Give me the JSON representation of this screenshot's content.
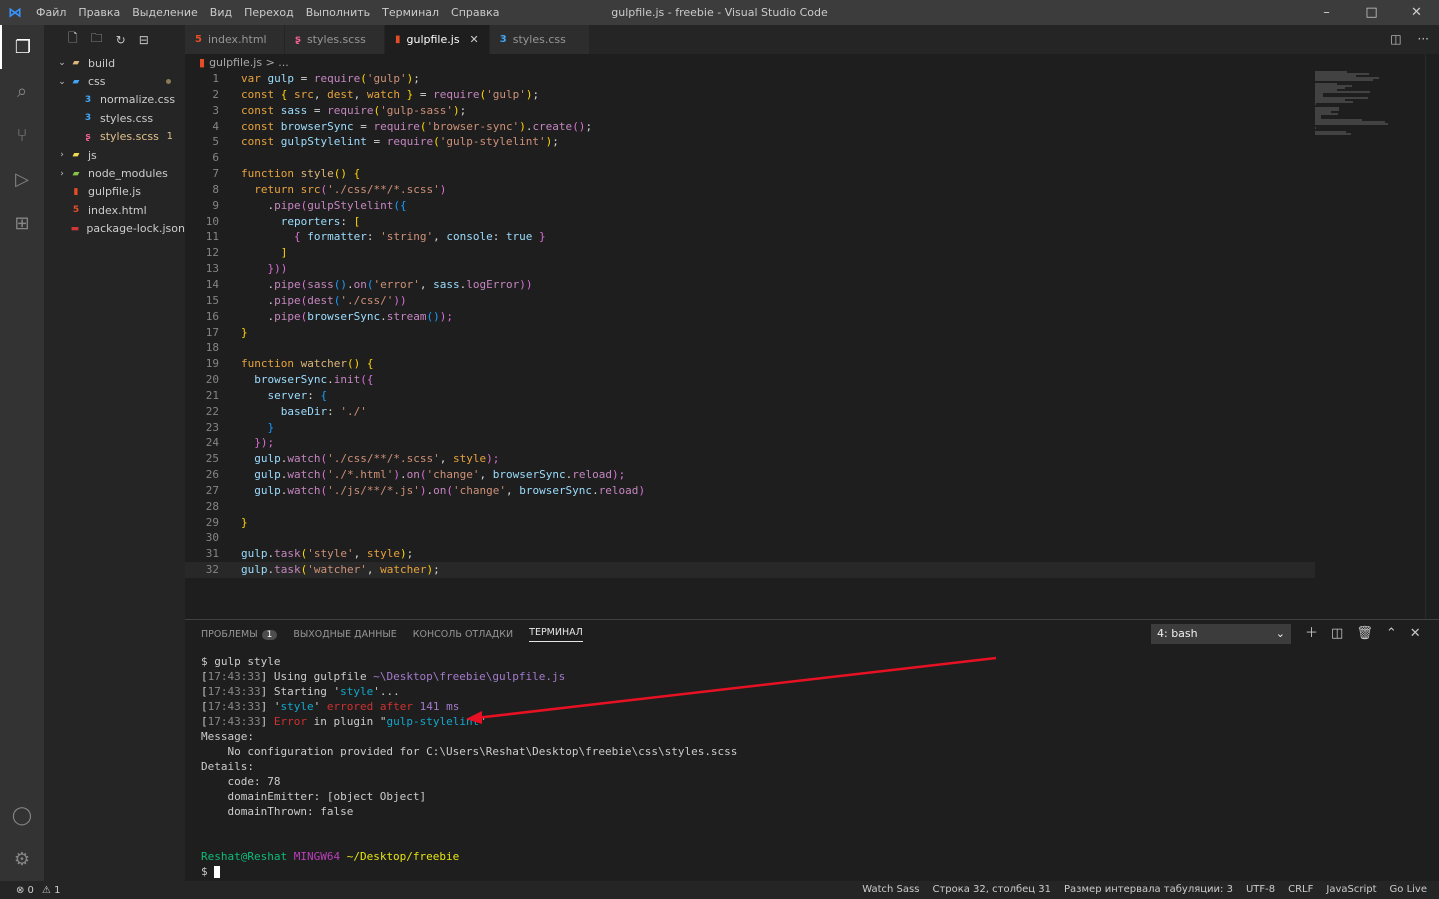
{
  "window": {
    "title": "gulpfile.js - freebie - Visual Studio Code",
    "menu": [
      "Файл",
      "Правка",
      "Выделение",
      "Вид",
      "Переход",
      "Выполнить",
      "Терминал",
      "Справка"
    ],
    "controls": [
      "–",
      "□",
      "✕"
    ]
  },
  "sidebar": {
    "items": [
      {
        "label": "build",
        "type": "folder",
        "chev": "⌄",
        "indent": 0
      },
      {
        "label": "css",
        "type": "folder-css",
        "chev": "⌄",
        "indent": 0
      },
      {
        "label": "normalize.css",
        "type": "css",
        "indent": 1
      },
      {
        "label": "styles.css",
        "type": "css",
        "indent": 1
      },
      {
        "label": "styles.scss",
        "type": "scss",
        "indent": 1,
        "badge": "1"
      },
      {
        "label": "js",
        "type": "folder-js",
        "chev": "›",
        "indent": 0
      },
      {
        "label": "node_modules",
        "type": "folder-node",
        "chev": "›",
        "indent": 0
      },
      {
        "label": "gulpfile.js",
        "type": "gulp",
        "indent": 0
      },
      {
        "label": "index.html",
        "type": "html",
        "indent": 0
      },
      {
        "label": "package-lock.json",
        "type": "npm",
        "indent": 0
      }
    ]
  },
  "tabs": [
    {
      "label": "index.html",
      "icon": "html"
    },
    {
      "label": "styles.scss",
      "icon": "scss"
    },
    {
      "label": "gulpfile.js",
      "icon": "gulp",
      "active": true
    },
    {
      "label": "styles.css",
      "icon": "css"
    }
  ],
  "breadcrumb": {
    "file": "gulpfile.js",
    "rest": " > ..."
  },
  "panel": {
    "tabs": [
      "ПРОБЛЕМЫ",
      "ВЫХОДНЫЕ ДАННЫЕ",
      "КОНСОЛЬ ОТЛАДКИ",
      "ТЕРМИНАЛ"
    ],
    "problems_count": "1",
    "terminal_select": "4: bash"
  },
  "terminal": {
    "lines": [
      {
        "parts": [
          {
            "t": "$ gulp style",
            "c": ""
          }
        ]
      },
      {
        "parts": [
          {
            "t": "[",
            "c": ""
          },
          {
            "t": "17:43:33",
            "c": "tgray"
          },
          {
            "t": "] Using gulpfile ",
            "c": ""
          },
          {
            "t": "~\\Desktop\\freebie\\gulpfile.js",
            "c": "tpurple"
          }
        ]
      },
      {
        "parts": [
          {
            "t": "[",
            "c": ""
          },
          {
            "t": "17:43:33",
            "c": "tgray"
          },
          {
            "t": "] Starting '",
            "c": ""
          },
          {
            "t": "style",
            "c": "tcyan"
          },
          {
            "t": "'...",
            "c": ""
          }
        ]
      },
      {
        "parts": [
          {
            "t": "[",
            "c": ""
          },
          {
            "t": "17:43:33",
            "c": "tgray"
          },
          {
            "t": "] '",
            "c": ""
          },
          {
            "t": "style",
            "c": "tcyan"
          },
          {
            "t": "' ",
            "c": ""
          },
          {
            "t": "errored after",
            "c": "tred"
          },
          {
            "t": " ",
            "c": ""
          },
          {
            "t": "141 ms",
            "c": "tpurple"
          }
        ]
      },
      {
        "parts": [
          {
            "t": "[",
            "c": ""
          },
          {
            "t": "17:43:33",
            "c": "tgray"
          },
          {
            "t": "] ",
            "c": ""
          },
          {
            "t": "Error",
            "c": "tred"
          },
          {
            "t": " in plugin \"",
            "c": ""
          },
          {
            "t": "gulp-stylelint",
            "c": "tcyan"
          },
          {
            "t": "\"",
            "c": ""
          }
        ]
      },
      {
        "parts": [
          {
            "t": "Message:",
            "c": ""
          }
        ]
      },
      {
        "parts": [
          {
            "t": "    No configuration provided for C:\\Users\\Reshat\\Desktop\\freebie\\css\\styles.scss",
            "c": ""
          }
        ]
      },
      {
        "parts": [
          {
            "t": "Details:",
            "c": ""
          }
        ]
      },
      {
        "parts": [
          {
            "t": "    code: 78",
            "c": ""
          }
        ]
      },
      {
        "parts": [
          {
            "t": "    domainEmitter: [object Object]",
            "c": ""
          }
        ]
      },
      {
        "parts": [
          {
            "t": "    domainThrown: false",
            "c": ""
          }
        ]
      },
      {
        "parts": [
          {
            "t": "",
            "c": ""
          }
        ]
      },
      {
        "parts": [
          {
            "t": "",
            "c": ""
          }
        ]
      },
      {
        "parts": [
          {
            "t": "Reshat@Reshat ",
            "c": "tgreen"
          },
          {
            "t": "MINGW64 ",
            "c": "tmag"
          },
          {
            "t": "~/Desktop/freebie",
            "c": "tyellow"
          }
        ]
      },
      {
        "parts": [
          {
            "t": "$ ",
            "c": ""
          }
        ]
      }
    ]
  },
  "code": [
    [
      [
        "var ",
        "k"
      ],
      [
        "gulp",
        "v"
      ],
      [
        " = ",
        "p"
      ],
      [
        "require",
        "f"
      ],
      [
        "(",
        "b"
      ],
      [
        "'gulp'",
        "s"
      ],
      [
        ")",
        "b"
      ],
      [
        ";",
        "p"
      ]
    ],
    [
      [
        "const ",
        "k"
      ],
      [
        "{ ",
        "b"
      ],
      [
        "src",
        "k"
      ],
      [
        ", ",
        "p"
      ],
      [
        "dest",
        "k"
      ],
      [
        ", ",
        "p"
      ],
      [
        "watch",
        "k"
      ],
      [
        " }",
        "b"
      ],
      [
        " = ",
        "p"
      ],
      [
        "require",
        "f"
      ],
      [
        "(",
        "b"
      ],
      [
        "'gulp'",
        "s"
      ],
      [
        ")",
        "b"
      ],
      [
        ";",
        "p"
      ]
    ],
    [
      [
        "const ",
        "k"
      ],
      [
        "sass",
        "v"
      ],
      [
        " = ",
        "p"
      ],
      [
        "require",
        "f"
      ],
      [
        "(",
        "b"
      ],
      [
        "'gulp-sass'",
        "s"
      ],
      [
        ")",
        "b"
      ],
      [
        ";",
        "p"
      ]
    ],
    [
      [
        "const ",
        "k"
      ],
      [
        "browserSync",
        "v"
      ],
      [
        " = ",
        "p"
      ],
      [
        "require",
        "f"
      ],
      [
        "(",
        "b"
      ],
      [
        "'browser-sync'",
        "s"
      ],
      [
        ")",
        "b"
      ],
      [
        ".",
        "p"
      ],
      [
        "create",
        "f"
      ],
      [
        "()",
        "pk"
      ],
      [
        ";",
        "p"
      ]
    ],
    [
      [
        "const ",
        "k"
      ],
      [
        "gulpStylelint",
        "v"
      ],
      [
        " = ",
        "p"
      ],
      [
        "require",
        "f"
      ],
      [
        "(",
        "b"
      ],
      [
        "'gulp-stylelint'",
        "s"
      ],
      [
        ")",
        "b"
      ],
      [
        ";",
        "p"
      ]
    ],
    [],
    [
      [
        "function ",
        "k"
      ],
      [
        "style",
        "fn"
      ],
      [
        "() ",
        "b"
      ],
      [
        "{",
        "b"
      ]
    ],
    [
      [
        "  ",
        "p"
      ],
      [
        "return ",
        "k"
      ],
      [
        "src",
        "k"
      ],
      [
        "(",
        "pk"
      ],
      [
        "'./css/**/*.scss'",
        "s"
      ],
      [
        ")",
        "pk"
      ]
    ],
    [
      [
        "    ",
        "p"
      ],
      [
        ".",
        "p"
      ],
      [
        "pipe",
        "f"
      ],
      [
        "(",
        "pk"
      ],
      [
        "gulpStylelint",
        "f"
      ],
      [
        "({",
        "bl"
      ]
    ],
    [
      [
        "      ",
        "p"
      ],
      [
        "reporters",
        "v"
      ],
      [
        ": ",
        "p"
      ],
      [
        "[",
        "b"
      ]
    ],
    [
      [
        "        ",
        "p"
      ],
      [
        "{ ",
        "pk"
      ],
      [
        "formatter",
        "v"
      ],
      [
        ": ",
        "p"
      ],
      [
        "'string'",
        "s"
      ],
      [
        ", ",
        "p"
      ],
      [
        "console",
        "v"
      ],
      [
        ": ",
        "p"
      ],
      [
        "true",
        "v"
      ],
      [
        " }",
        "pk"
      ]
    ],
    [
      [
        "      ",
        "p"
      ],
      [
        "]",
        "b"
      ]
    ],
    [
      [
        "    ",
        "p"
      ],
      [
        "}))",
        "pk"
      ]
    ],
    [
      [
        "    ",
        "p"
      ],
      [
        ".",
        "p"
      ],
      [
        "pipe",
        "f"
      ],
      [
        "(",
        "pk"
      ],
      [
        "sass",
        "f"
      ],
      [
        "()",
        "bl"
      ],
      [
        ".",
        "p"
      ],
      [
        "on",
        "f"
      ],
      [
        "(",
        "bl"
      ],
      [
        "'error'",
        "s"
      ],
      [
        ", ",
        "p"
      ],
      [
        "sass",
        "v"
      ],
      [
        ".",
        "p"
      ],
      [
        "logError",
        "f"
      ],
      [
        "))",
        "pk"
      ]
    ],
    [
      [
        "    ",
        "p"
      ],
      [
        ".",
        "p"
      ],
      [
        "pipe",
        "f"
      ],
      [
        "(",
        "pk"
      ],
      [
        "dest",
        "f"
      ],
      [
        "(",
        "bl"
      ],
      [
        "'./css/'",
        "s"
      ],
      [
        "))",
        "pk"
      ]
    ],
    [
      [
        "    ",
        "p"
      ],
      [
        ".",
        "p"
      ],
      [
        "pipe",
        "f"
      ],
      [
        "(",
        "pk"
      ],
      [
        "browserSync",
        "v"
      ],
      [
        ".",
        "p"
      ],
      [
        "stream",
        "f"
      ],
      [
        "()",
        "bl"
      ],
      [
        ");",
        "pk"
      ]
    ],
    [
      [
        "}",
        "b"
      ]
    ],
    [],
    [
      [
        "function ",
        "k"
      ],
      [
        "watcher",
        "fn"
      ],
      [
        "() ",
        "b"
      ],
      [
        "{",
        "b"
      ]
    ],
    [
      [
        "  ",
        "p"
      ],
      [
        "browserSync",
        "v"
      ],
      [
        ".",
        "p"
      ],
      [
        "init",
        "f"
      ],
      [
        "({",
        "pk"
      ]
    ],
    [
      [
        "    ",
        "p"
      ],
      [
        "server",
        "v"
      ],
      [
        ": ",
        "p"
      ],
      [
        "{",
        "bl"
      ]
    ],
    [
      [
        "      ",
        "p"
      ],
      [
        "baseDir",
        "v"
      ],
      [
        ": ",
        "p"
      ],
      [
        "'./'",
        "s"
      ]
    ],
    [
      [
        "    ",
        "p"
      ],
      [
        "}",
        "bl"
      ]
    ],
    [
      [
        "  ",
        "p"
      ],
      [
        "});",
        "pk"
      ]
    ],
    [
      [
        "  ",
        "p"
      ],
      [
        "gulp",
        "v"
      ],
      [
        ".",
        "p"
      ],
      [
        "watch",
        "f"
      ],
      [
        "(",
        "pk"
      ],
      [
        "'./css/**/*.scss'",
        "s"
      ],
      [
        ", ",
        "p"
      ],
      [
        "style",
        "k"
      ],
      [
        ");",
        "pk"
      ]
    ],
    [
      [
        "  ",
        "p"
      ],
      [
        "gulp",
        "v"
      ],
      [
        ".",
        "p"
      ],
      [
        "watch",
        "f"
      ],
      [
        "(",
        "pk"
      ],
      [
        "'./*.html'",
        "s"
      ],
      [
        ")",
        "pk"
      ],
      [
        ".",
        "p"
      ],
      [
        "on",
        "f"
      ],
      [
        "(",
        "pk"
      ],
      [
        "'change'",
        "s"
      ],
      [
        ", ",
        "p"
      ],
      [
        "browserSync",
        "v"
      ],
      [
        ".",
        "p"
      ],
      [
        "reload",
        "f"
      ],
      [
        ");",
        "pk"
      ]
    ],
    [
      [
        "  ",
        "p"
      ],
      [
        "gulp",
        "v"
      ],
      [
        ".",
        "p"
      ],
      [
        "watch",
        "f"
      ],
      [
        "(",
        "pk"
      ],
      [
        "'./js/**/*.js'",
        "s"
      ],
      [
        ")",
        "pk"
      ],
      [
        ".",
        "p"
      ],
      [
        "on",
        "f"
      ],
      [
        "(",
        "pk"
      ],
      [
        "'change'",
        "s"
      ],
      [
        ", ",
        "p"
      ],
      [
        "browserSync",
        "v"
      ],
      [
        ".",
        "p"
      ],
      [
        "reload",
        "f"
      ],
      [
        ")",
        "pk"
      ]
    ],
    [],
    [
      [
        "}",
        "b"
      ]
    ],
    [],
    [
      [
        "gulp",
        "v"
      ],
      [
        ".",
        "p"
      ],
      [
        "task",
        "f"
      ],
      [
        "(",
        "b"
      ],
      [
        "'style'",
        "s"
      ],
      [
        ", ",
        "p"
      ],
      [
        "style",
        "k"
      ],
      [
        ")",
        "b"
      ],
      [
        ";",
        "p"
      ]
    ],
    [
      [
        "gulp",
        "v"
      ],
      [
        ".",
        "p"
      ],
      [
        "task",
        "f"
      ],
      [
        "(",
        "b"
      ],
      [
        "'watcher'",
        "s"
      ],
      [
        ", ",
        "p"
      ],
      [
        "watcher",
        "k"
      ],
      [
        ")",
        "b"
      ],
      [
        ";",
        "p"
      ]
    ]
  ],
  "current_line": 32,
  "statusbar": {
    "errors": "⊗ 0",
    "warnings": "⚠ 1",
    "right": [
      "Watch Sass",
      "Строка 32, столбец 31",
      "Размер интервала табуляции: 3",
      "UTF-8",
      "CRLF",
      "JavaScript",
      "Go Live"
    ]
  },
  "colors": {
    "accent": "#3794ff",
    "error": "#cd3131",
    "arrow": "#e81123"
  }
}
